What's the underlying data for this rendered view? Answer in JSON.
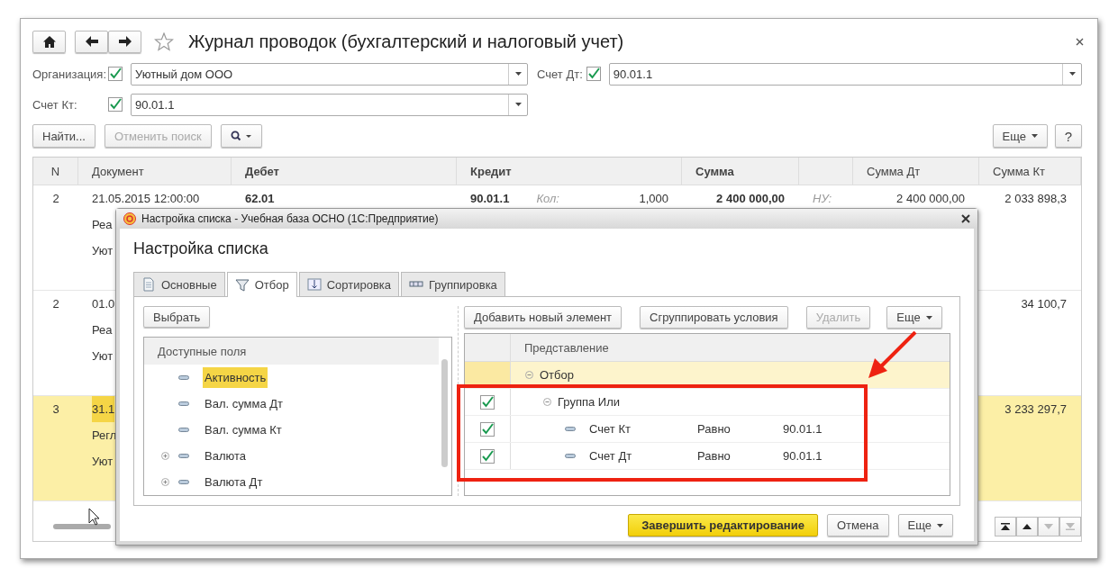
{
  "window": {
    "title": "Журнал проводок (бухгалтерский и налоговый учет)"
  },
  "filters": [
    {
      "label": "Организация:",
      "checked": true,
      "value": "Уютный дом ООО"
    },
    {
      "label": "Счет Дт:",
      "checked": true,
      "value": "90.01.1"
    },
    {
      "label": "Счет Кт:",
      "checked": true,
      "value": "90.01.1"
    }
  ],
  "toolbar": [
    {
      "label": "Найти...",
      "disabled": false
    },
    {
      "label": "Отменить поиск",
      "disabled": true
    }
  ],
  "toolbar_right": [
    {
      "label": "Еще",
      "kind": "menu"
    },
    {
      "label": "?",
      "kind": "plain"
    }
  ],
  "table": {
    "columns": {
      "n": "N",
      "document": "Документ",
      "debit": "Дебет",
      "credit": "Кредит",
      "sum": "Сумма",
      "sum_dt": "Сумма Дт",
      "sum_kt": "Сумма Кт"
    },
    "rows": [
      {
        "n": "2",
        "document": [
          "21.05.2015 12:00:00",
          "Реа",
          "Уют"
        ],
        "debit": "62.01",
        "credit": "90.01.1",
        "qty_label": "Кол:",
        "qty": "1,000",
        "sum": "2 400 000,00",
        "nu_label": "НУ:",
        "sum_dt": "2 400 000,00",
        "sum_kt": "2 033 898,3",
        "selected": false
      },
      {
        "n": "2",
        "document": [
          "01.0",
          "Реа",
          "Уют"
        ],
        "sum_kt": "34 100,7",
        "selected": false
      },
      {
        "n": "3",
        "document": [
          "31.1",
          "Регл",
          "Уют"
        ],
        "sum_kt": "3 233 297,7",
        "selected": true
      }
    ]
  },
  "dialog": {
    "title": "Настройка списка - Учебная база ОСНО  (1С:Предприятие)",
    "heading": "Настройка списка",
    "tabs": [
      {
        "label": "Основные",
        "kind": "general",
        "selected": false
      },
      {
        "label": "Отбор",
        "kind": "filter",
        "selected": true
      },
      {
        "label": "Сортировка",
        "kind": "sort",
        "selected": false
      },
      {
        "label": "Группировка",
        "kind": "group",
        "selected": false
      }
    ],
    "select_button": "Выбрать",
    "fields_header": "Доступные поля",
    "fields": [
      {
        "label": "Активность",
        "expandable": false,
        "selected": true
      },
      {
        "label": "Вал. сумма Дт",
        "expandable": false,
        "selected": false
      },
      {
        "label": "Вал. сумма Кт",
        "expandable": false,
        "selected": false
      },
      {
        "label": "Валюта",
        "expandable": true,
        "selected": false
      },
      {
        "label": "Валюта Дт",
        "expandable": true,
        "selected": false
      }
    ],
    "filter_buttons": [
      {
        "label": "Добавить новый элемент",
        "kind": "plain",
        "disabled": false
      },
      {
        "label": "Сгруппировать условия",
        "kind": "plain",
        "disabled": false
      },
      {
        "label": "Удалить",
        "kind": "plain",
        "disabled": true
      },
      {
        "label": "Еще",
        "kind": "menu",
        "disabled": false
      }
    ],
    "filter_header": "Представление",
    "filter_tree": [
      {
        "label": "Отбор",
        "selected": true,
        "children": [
          {
            "label": "Группа Или",
            "checked": true,
            "selected": false,
            "children": [
              {
                "label": "Счет Кт",
                "checked": true,
                "selected": false,
                "comparison": "Равно",
                "value": "90.01.1"
              },
              {
                "label": "Счет Дт",
                "checked": true,
                "selected": false,
                "comparison": "Равно",
                "value": "90.01.1"
              }
            ]
          }
        ]
      }
    ],
    "footer_buttons": [
      {
        "label": "Завершить редактирование",
        "kind": "primary"
      },
      {
        "label": "Отмена",
        "kind": "plain"
      },
      {
        "label": "Еще",
        "kind": "menu"
      }
    ]
  }
}
